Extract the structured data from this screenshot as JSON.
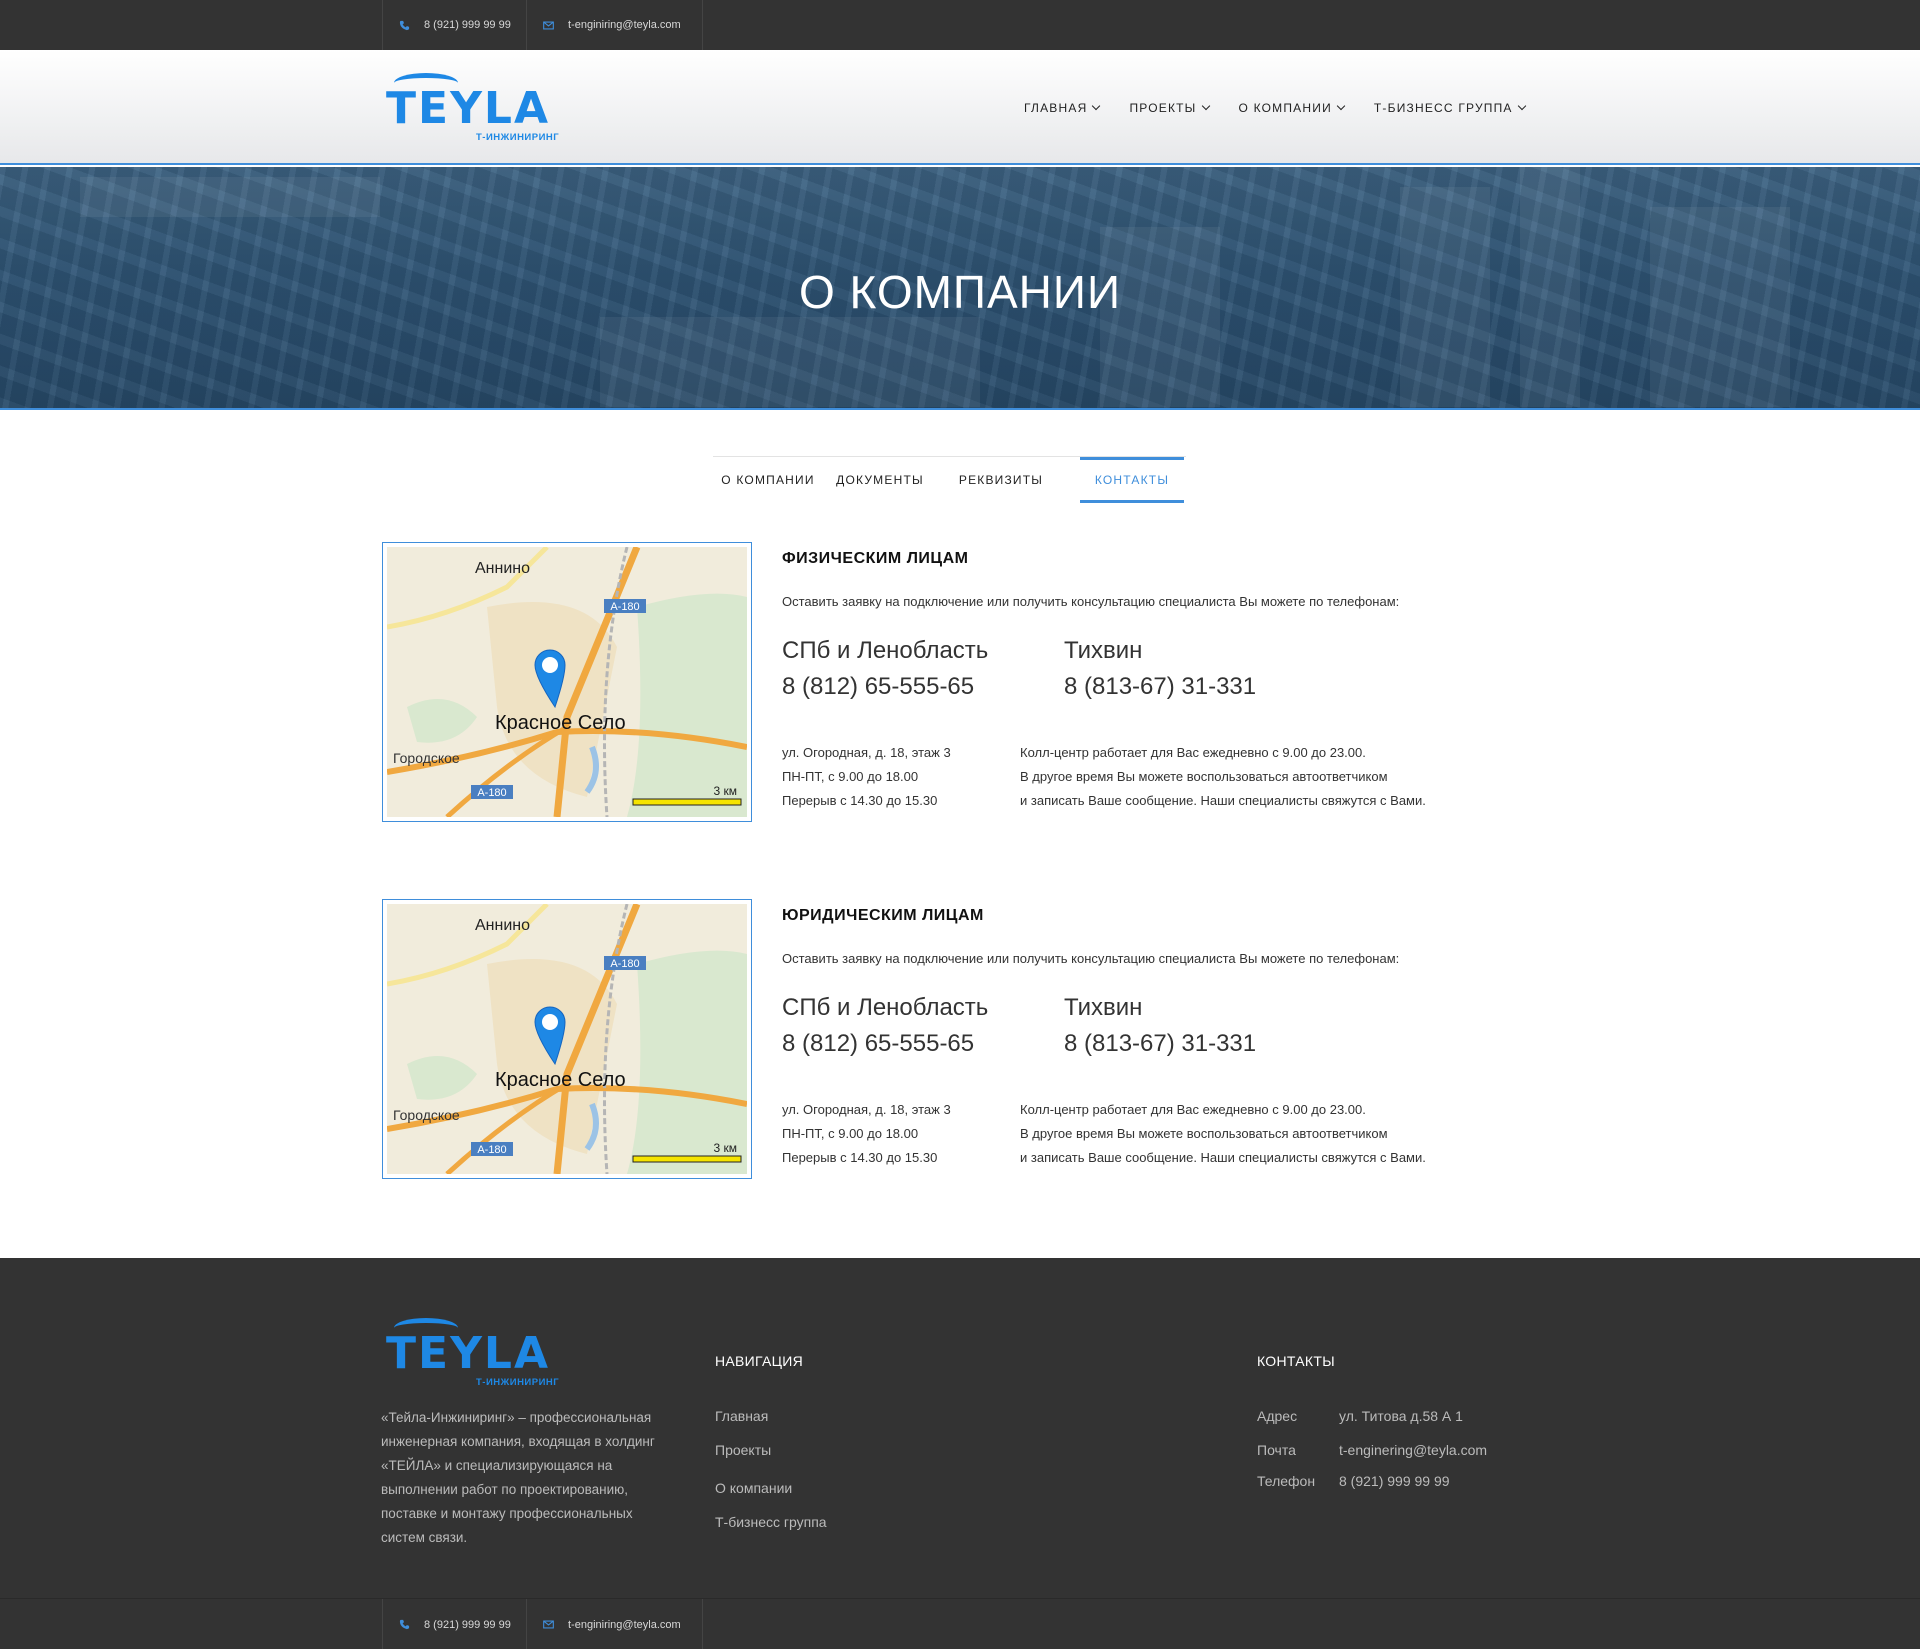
{
  "topbar": {
    "phone": "8 (921) 999 99 99",
    "email": "t-enginiring@teyla.com"
  },
  "logo": {
    "word": "TEYLA",
    "sub": "Т-ИНЖИНИРИНГ"
  },
  "nav": {
    "items": [
      {
        "label": "ГЛАВНАЯ"
      },
      {
        "label": "ПРОЕКТЫ"
      },
      {
        "label": "О КОМПАНИИ"
      },
      {
        "label": "Т-БИЗНЕСС ГРУППА"
      }
    ]
  },
  "hero": {
    "title": "О КОМПАНИИ"
  },
  "tabs": [
    {
      "label": "О КОМПАНИИ"
    },
    {
      "label": "ДОКУМЕНТЫ"
    },
    {
      "label": "РЕКВИЗИТЫ"
    },
    {
      "label": "КОНТАКТЫ"
    }
  ],
  "map": {
    "town1": "Аннино",
    "town2": "Красное Село",
    "town3": "Городское",
    "road": "A-180",
    "scale": "3 км"
  },
  "blocks": [
    {
      "heading": "ФИЗИЧЕСКИМ ЛИЦАМ",
      "intro": "Оставить заявку на подключение или получить консультацию специалиста Вы можете по телефонам:",
      "region1": "СПб и Ленобласть",
      "phone1": "8 (812) 65-555-65",
      "region2": "Тихвин",
      "phone2": "8 (813-67) 31-331",
      "addr1": "ул. Огородная, д. 18, этаж 3",
      "addr2": "ПН-ПТ, с 9.00 до 18.00",
      "addr3": "Перерыв с 14.30 до 15.30",
      "note1": "Колл-центр работает для Вас ежедневно с 9.00 до 23.00.",
      "note2": "В другое время Вы можете воспользоваться автоответчиком",
      "note3": "и записать Ваше сообщение. Наши специалисты свяжутся с Вами."
    },
    {
      "heading": "ЮРИДИЧЕСКИМ ЛИЦАМ",
      "intro": "Оставить заявку на подключение или получить консультацию специалиста Вы можете по телефонам:",
      "region1": "СПб и Ленобласть",
      "phone1": "8 (812) 65-555-65",
      "region2": "Тихвин",
      "phone2": "8 (813-67) 31-331",
      "addr1": "ул. Огородная, д. 18, этаж 3",
      "addr2": "ПН-ПТ, с 9.00 до 18.00",
      "addr3": "Перерыв с 14.30 до 15.30",
      "note1": "Колл-центр работает для Вас ежедневно с 9.00 до 23.00.",
      "note2": "В другое время Вы можете воспользоваться автоответчиком",
      "note3": "и записать Ваше сообщение. Наши специалисты свяжутся с Вами."
    }
  ],
  "footer": {
    "about": "«Тейла-Инжиниринг» – профессиональная инженерная компания, входящая в холдинг «ТЕЙЛА» и специализирующаяся на выполнении работ по проектированию, поставке и монтажу профессиональных систем связи.",
    "nav_heading": "НАВИГАЦИЯ",
    "nav_links": [
      "Главная",
      "Проекты",
      "О компании",
      "Т-бизнесс группа"
    ],
    "contacts_heading": "КОНТАКТЫ",
    "contacts": [
      {
        "key": "Адрес",
        "value": "ул. Титова д.58 А 1"
      },
      {
        "key": "Почта",
        "value": "t-enginering@teyla.com"
      },
      {
        "key": "Телефон",
        "value": "8 (921) 999 99 99"
      }
    ]
  },
  "bottombar": {
    "phone": "8 (921) 999 99 99",
    "email": "t-enginiring@teyla.com"
  },
  "colors": {
    "accent": "#3f8edb",
    "logo": "#1e88e5",
    "dark": "#333333"
  }
}
